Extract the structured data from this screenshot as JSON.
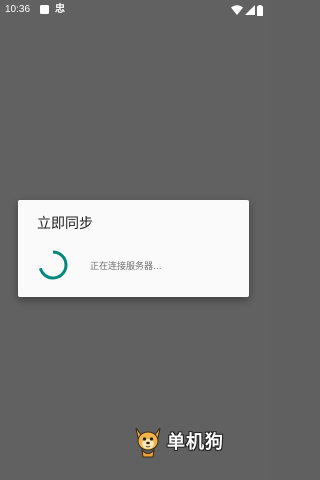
{
  "status_bar": {
    "time": "10:36",
    "app_glyph": "忠",
    "icons": [
      "notification-square-icon",
      "wifi-icon",
      "signal-icon",
      "battery-icon"
    ]
  },
  "dialog": {
    "title": "立即同步",
    "message": "正在连接服务器...",
    "spinner_color": "#00897B"
  },
  "watermark": {
    "text": "单机狗"
  }
}
